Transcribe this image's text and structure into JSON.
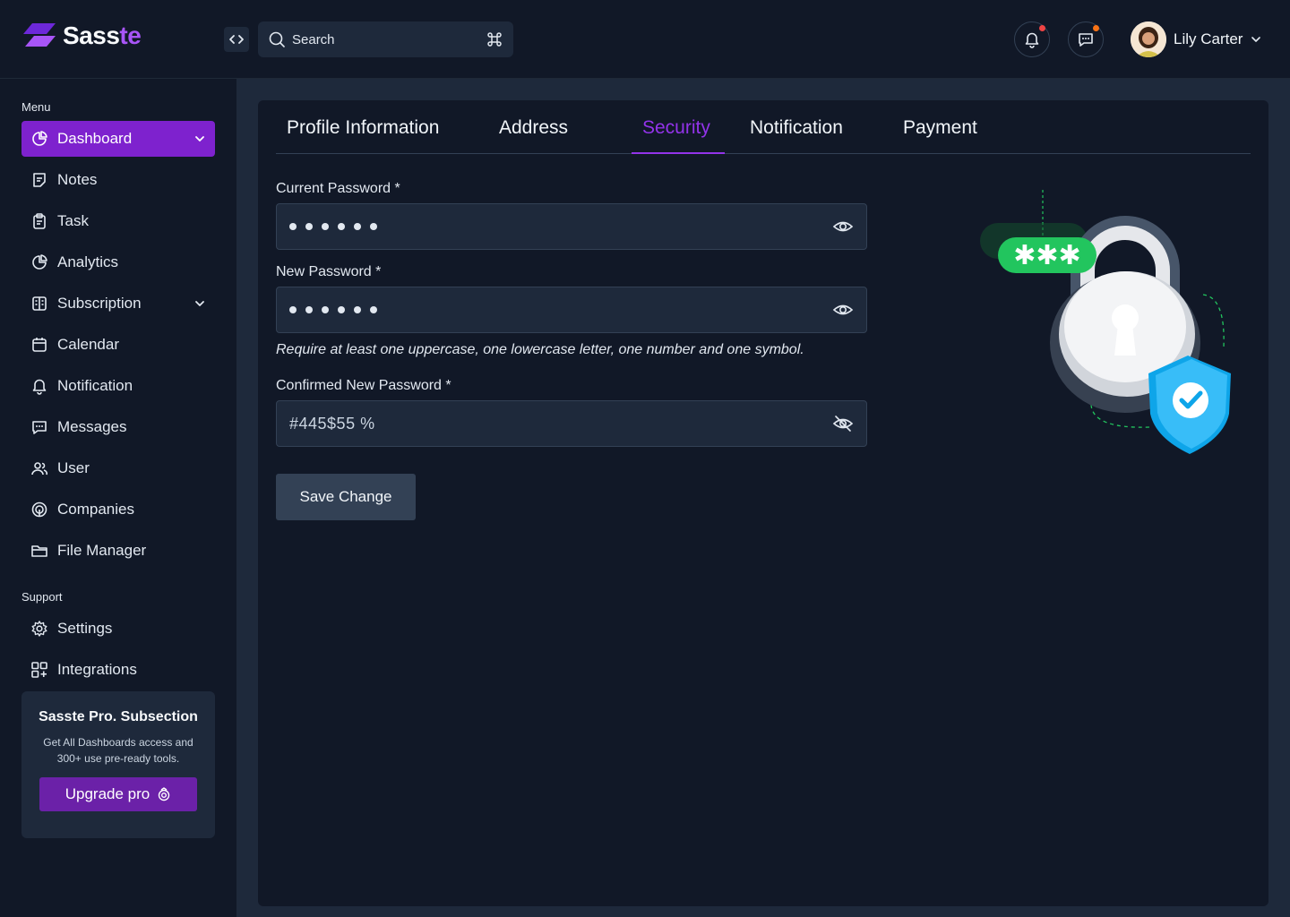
{
  "brand": {
    "name_part1": "Sass",
    "name_part2": "te"
  },
  "search": {
    "placeholder": "Search"
  },
  "user": {
    "name": "Lily Carter"
  },
  "sidebar": {
    "menu_label": "Menu",
    "support_label": "Support",
    "items": [
      {
        "label": "Dashboard",
        "icon": "pie-chart-icon",
        "active": true,
        "has_chevron": true
      },
      {
        "label": "Notes",
        "icon": "note-icon"
      },
      {
        "label": "Task",
        "icon": "clipboard-icon"
      },
      {
        "label": "Analytics",
        "icon": "pie-chart-icon"
      },
      {
        "label": "Subscription",
        "icon": "subscription-icon",
        "has_chevron": true
      },
      {
        "label": "Calendar",
        "icon": "calendar-icon"
      },
      {
        "label": "Notification",
        "icon": "bell-icon"
      },
      {
        "label": "Messages",
        "icon": "chat-icon"
      },
      {
        "label": "User",
        "icon": "users-icon"
      },
      {
        "label": "Companies",
        "icon": "fingerprint-icon"
      },
      {
        "label": "File Manager",
        "icon": "folder-icon"
      }
    ],
    "support_items": [
      {
        "label": "Settings",
        "icon": "gear-icon"
      },
      {
        "label": "Integrations",
        "icon": "grid-plus-icon"
      }
    ],
    "promo": {
      "title": "Sasste Pro. Subsection",
      "description": "Get All Dashboards access and 300+ use pre-ready tools.",
      "button": "Upgrade pro"
    }
  },
  "tabs": [
    {
      "label": "Profile Information"
    },
    {
      "label": "Address"
    },
    {
      "label": "Security",
      "active": true
    },
    {
      "label": "Notification"
    },
    {
      "label": "Payment"
    }
  ],
  "form": {
    "current_password_label": "Current Password *",
    "new_password_label": "New Password *",
    "hint": "Require at least one uppercase, one lowercase letter, one number and one symbol.",
    "confirm_password_label": "Confirmed New Password *",
    "confirm_password_value": "#445$55 %",
    "save_button": "Save Change"
  },
  "colors": {
    "accent": "#9333ea",
    "active_nav": "#7e22ce",
    "notification_dot": "#ef4444",
    "message_dot": "#f97316",
    "badge_green": "#22c55e",
    "shield_blue": "#38bdf8"
  }
}
